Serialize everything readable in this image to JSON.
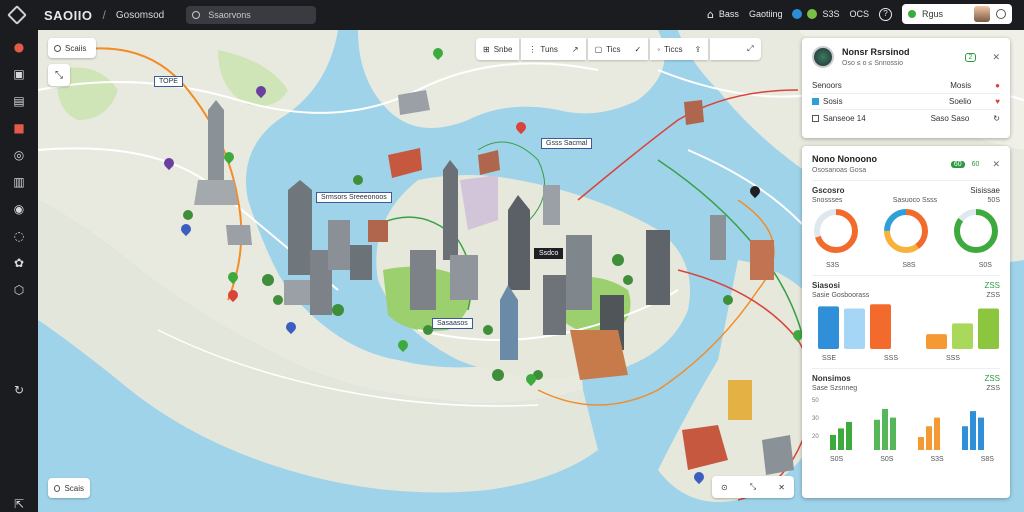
{
  "topbar": {
    "brand": "SAOIIO",
    "separator": "/",
    "context": "Gosomsod",
    "search_placeholder": "Ssaorvons",
    "items": [
      {
        "label": "Bass",
        "icon": "home-icon"
      },
      {
        "label": "Gaotiing",
        "icon": ""
      },
      {
        "label": "S3S",
        "icon": "location-icon"
      },
      {
        "label": "OCS",
        "icon": ""
      }
    ],
    "help_icon": "help-icon",
    "profile_label": "Rgus"
  },
  "rail": {
    "icons": [
      "layers-icon",
      "bug-icon",
      "document-icon",
      "board-icon",
      "briefcase-icon",
      "globe-icon",
      "books-icon",
      "chat-icon",
      "compass-icon",
      "plant-icon",
      "settings-cube-icon",
      "refresh-icon",
      "logout-icon"
    ]
  },
  "map": {
    "top_left_chip": "Scaiis",
    "bottom_left_chip": "Scais",
    "toolbar": [
      {
        "label": "Snbe",
        "icon": "grid-icon"
      },
      {
        "label": "Tuns",
        "icon": "ruler-icon"
      },
      {
        "label": "Tics",
        "icon": "square-icon"
      },
      {
        "label": "Ticcs",
        "icon": "mic-icon"
      }
    ],
    "labels": [
      {
        "text": "Srmsors Sreeeonoos",
        "dark": false
      },
      {
        "text": "Gsss Sacmal",
        "dark": false
      },
      {
        "text": "Ssdco",
        "dark": true
      },
      {
        "text": "Sasaasos",
        "dark": false
      },
      {
        "text": "TOPE",
        "dark": false
      }
    ]
  },
  "panel_info": {
    "title": "Nonsr Rsrsinod",
    "subtitle": "Oso ≤ o ≤ Snnossio",
    "badge": "2",
    "rows": [
      {
        "label": "Senoors",
        "value": "Mosis",
        "icon": "pin-icon"
      },
      {
        "label": "Sosis",
        "value": "Soelio",
        "icon": "shield-icon"
      },
      {
        "label": "Sanseoe 14",
        "value": "Saso Saso",
        "icon": "refresh-icon"
      }
    ]
  },
  "panel_stats": {
    "title": "Nono Nonoono",
    "subtitle": "Ososanoas Gosa",
    "badges": [
      "60",
      "60"
    ],
    "donut_section": {
      "left_label": "Gscosro",
      "left_sub": "Snossses",
      "right_label": "Sisissae",
      "right_sub": "Sasuoco Ssss",
      "right_value": "50S",
      "donut_captions": [
        "S3S",
        "S8S",
        "S0S"
      ]
    },
    "bar_section_1": {
      "title": "Siasosi",
      "subtitle": "Sasie Gosboorass",
      "value_a": "ZSS",
      "value_b": "ZSS",
      "captions": [
        "SSE",
        "SSS",
        "SSS"
      ]
    },
    "bar_section_2": {
      "title": "Nonsimos",
      "subtitle": "Sase Szsnneg",
      "value_a": "ZSS",
      "value_b": "ZSS",
      "axis": [
        "50",
        "30",
        "20"
      ],
      "captions": [
        "S0S",
        "S0S",
        "S3S",
        "S8S"
      ]
    }
  },
  "chart_data": [
    {
      "type": "pie",
      "series": [
        {
          "values": [
            0.7,
            0.3
          ],
          "colors": [
            "#f26b2c",
            "#dfe8ef"
          ]
        },
        {
          "values": [
            0.4,
            0.35,
            0.25
          ],
          "colors": [
            "#f26b2c",
            "#f6b23b",
            "#2f9fd8"
          ]
        },
        {
          "values": [
            0.85,
            0.15
          ],
          "colors": [
            "#3eaa3e",
            "#dfe8ef"
          ]
        }
      ]
    },
    {
      "type": "bar",
      "series": [
        {
          "values": [
            40,
            38,
            42
          ],
          "colors": [
            "#2f8fd8",
            "#a6d6f5",
            "#f26b2c"
          ]
        },
        {
          "values": [
            14,
            24,
            38
          ],
          "colors": [
            "#f59a32",
            "#a9d85a",
            "#8cc63f"
          ]
        }
      ],
      "ylim": [
        0,
        45
      ]
    },
    {
      "type": "bar",
      "series": [
        {
          "values": [
            14,
            20,
            26
          ],
          "color": "#3eaa3e"
        },
        {
          "values": [
            28,
            38,
            30
          ],
          "color": "#57b65a"
        },
        {
          "values": [
            12,
            22,
            30
          ],
          "color": "#f59a32"
        },
        {
          "values": [
            22,
            36,
            30
          ],
          "color": "#2f8fd8"
        }
      ],
      "ylim": [
        0,
        50
      ]
    }
  ]
}
